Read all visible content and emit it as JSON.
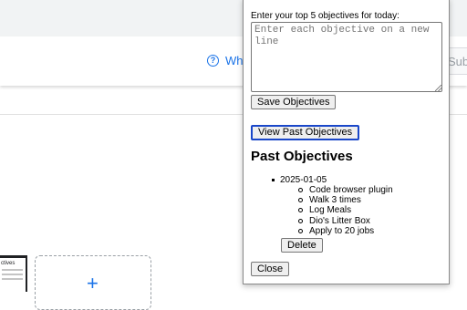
{
  "background_page": {
    "help_icon_glyph": "?",
    "help_link_text": "Wh",
    "submit_text": "Subm",
    "thumbnail_text": "ctives",
    "add_glyph": "+"
  },
  "popup": {
    "prompt": "Enter your top 5 objectives for today:",
    "textarea_placeholder": "Enter each objective on a new line",
    "textarea_value": "",
    "save_label": "Save Objectives",
    "view_label": "View Past Objectives",
    "past_heading": "Past Objectives",
    "past_entries": [
      {
        "date": "2025-01-05",
        "objectives": [
          "Code browser plugin",
          "Walk 3 times",
          "Log Meals",
          "Dio's Litter Box",
          "Apply to 20 jobs"
        ],
        "delete_label": "Delete"
      }
    ],
    "close_label": "Close"
  },
  "colors": {
    "link_blue": "#1a73e8",
    "focus_ring": "#1a47c9",
    "button_bg": "#efefef"
  }
}
